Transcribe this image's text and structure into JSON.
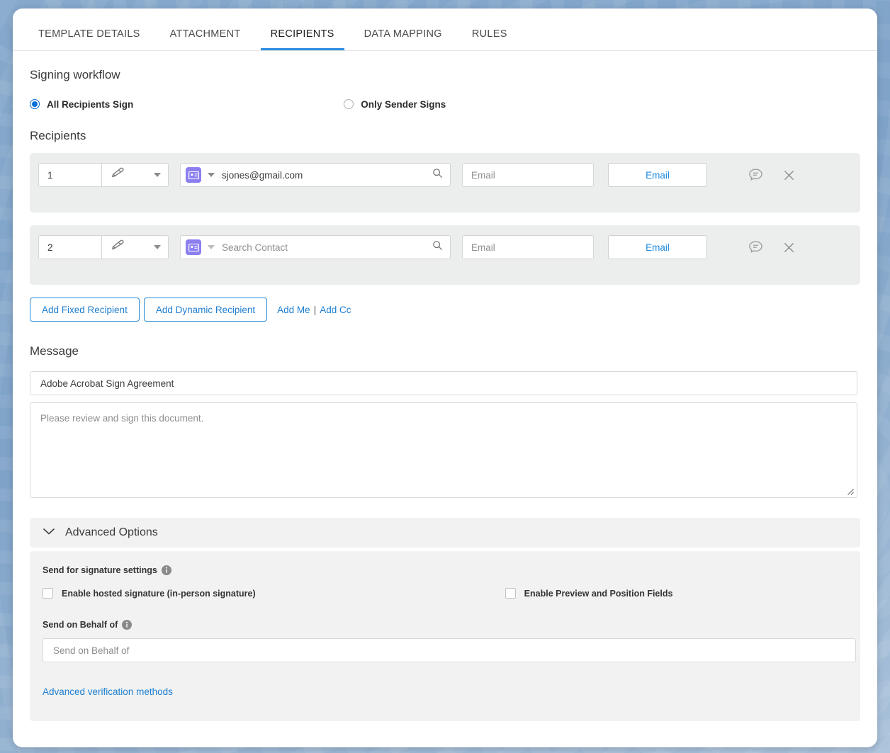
{
  "tabs": [
    {
      "label": "TEMPLATE DETAILS",
      "active": false
    },
    {
      "label": "ATTACHMENT",
      "active": false
    },
    {
      "label": "RECIPIENTS",
      "active": true
    },
    {
      "label": "DATA MAPPING",
      "active": false
    },
    {
      "label": "RULES",
      "active": false
    }
  ],
  "signing_workflow": {
    "title": "Signing workflow",
    "options": [
      {
        "label": "All Recipients Sign",
        "selected": true
      },
      {
        "label": "Only Sender Signs",
        "selected": false
      }
    ]
  },
  "recipients": {
    "title": "Recipients",
    "rows": [
      {
        "order": "1",
        "role_icon": "signature-pen-icon",
        "contact_badge": "contact-card-icon",
        "contact_value": "sjones@gmail.com",
        "contact_is_placeholder": false,
        "email_placeholder": "Email",
        "email_button": "Email"
      },
      {
        "order": "2",
        "role_icon": "signature-pen-icon",
        "contact_badge": "contact-card-icon",
        "contact_value": "Search Contact",
        "contact_is_placeholder": true,
        "email_placeholder": "Email",
        "email_button": "Email"
      }
    ],
    "add_fixed_label": "Add Fixed Recipient",
    "add_dynamic_label": "Add Dynamic Recipient",
    "add_me_label": "Add Me",
    "link_separator": "|",
    "add_cc_label": "Add Cc"
  },
  "message": {
    "title": "Message",
    "subject_value": "Adobe Acrobat Sign Agreement",
    "body_placeholder": "Please review and sign this document."
  },
  "advanced_options": {
    "title": "Advanced Options",
    "expanded": true,
    "signature_settings_label": "Send for signature settings",
    "checkbox_hosted_signature": "Enable hosted signature (in-person signature)",
    "checkbox_preview_position": "Enable Preview and Position Fields",
    "send_on_behalf_label": "Send on Behalf of",
    "send_on_behalf_placeholder": "Send on Behalf of",
    "advanced_verification_link": "Advanced verification methods"
  },
  "colors": {
    "accent_blue": "#1e7fd0",
    "tab_underline": "#2b8ce0",
    "badge_purple": "#8b7ff0",
    "row_background": "#eceded",
    "panel_background": "#f2f2f2"
  }
}
